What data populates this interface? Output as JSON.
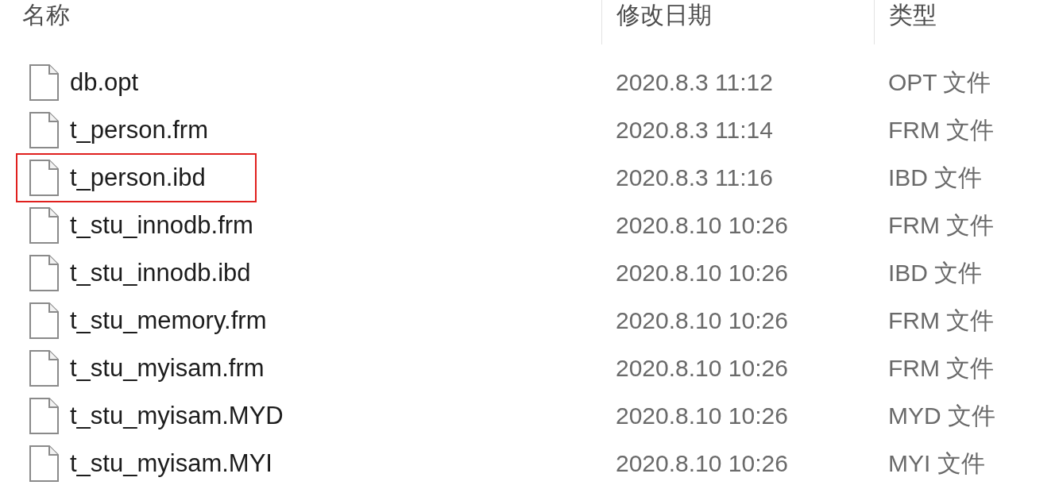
{
  "columns": [
    "名称",
    "修改日期",
    "类型"
  ],
  "files": [
    {
      "name": "db.opt",
      "modified": "2020.8.3 11:12",
      "type": "OPT 文件",
      "highlighted": false
    },
    {
      "name": "t_person.frm",
      "modified": "2020.8.3 11:14",
      "type": "FRM 文件",
      "highlighted": false
    },
    {
      "name": "t_person.ibd",
      "modified": "2020.8.3 11:16",
      "type": "IBD 文件",
      "highlighted": true
    },
    {
      "name": "t_stu_innodb.frm",
      "modified": "2020.8.10 10:26",
      "type": "FRM 文件",
      "highlighted": false
    },
    {
      "name": "t_stu_innodb.ibd",
      "modified": "2020.8.10 10:26",
      "type": "IBD 文件",
      "highlighted": false
    },
    {
      "name": "t_stu_memory.frm",
      "modified": "2020.8.10 10:26",
      "type": "FRM 文件",
      "highlighted": false
    },
    {
      "name": "t_stu_myisam.frm",
      "modified": "2020.8.10 10:26",
      "type": "FRM 文件",
      "highlighted": false
    },
    {
      "name": "t_stu_myisam.MYD",
      "modified": "2020.8.10 10:26",
      "type": "MYD 文件",
      "highlighted": false
    },
    {
      "name": "t_stu_myisam.MYI",
      "modified": "2020.8.10 10:26",
      "type": "MYI 文件",
      "highlighted": false
    }
  ]
}
